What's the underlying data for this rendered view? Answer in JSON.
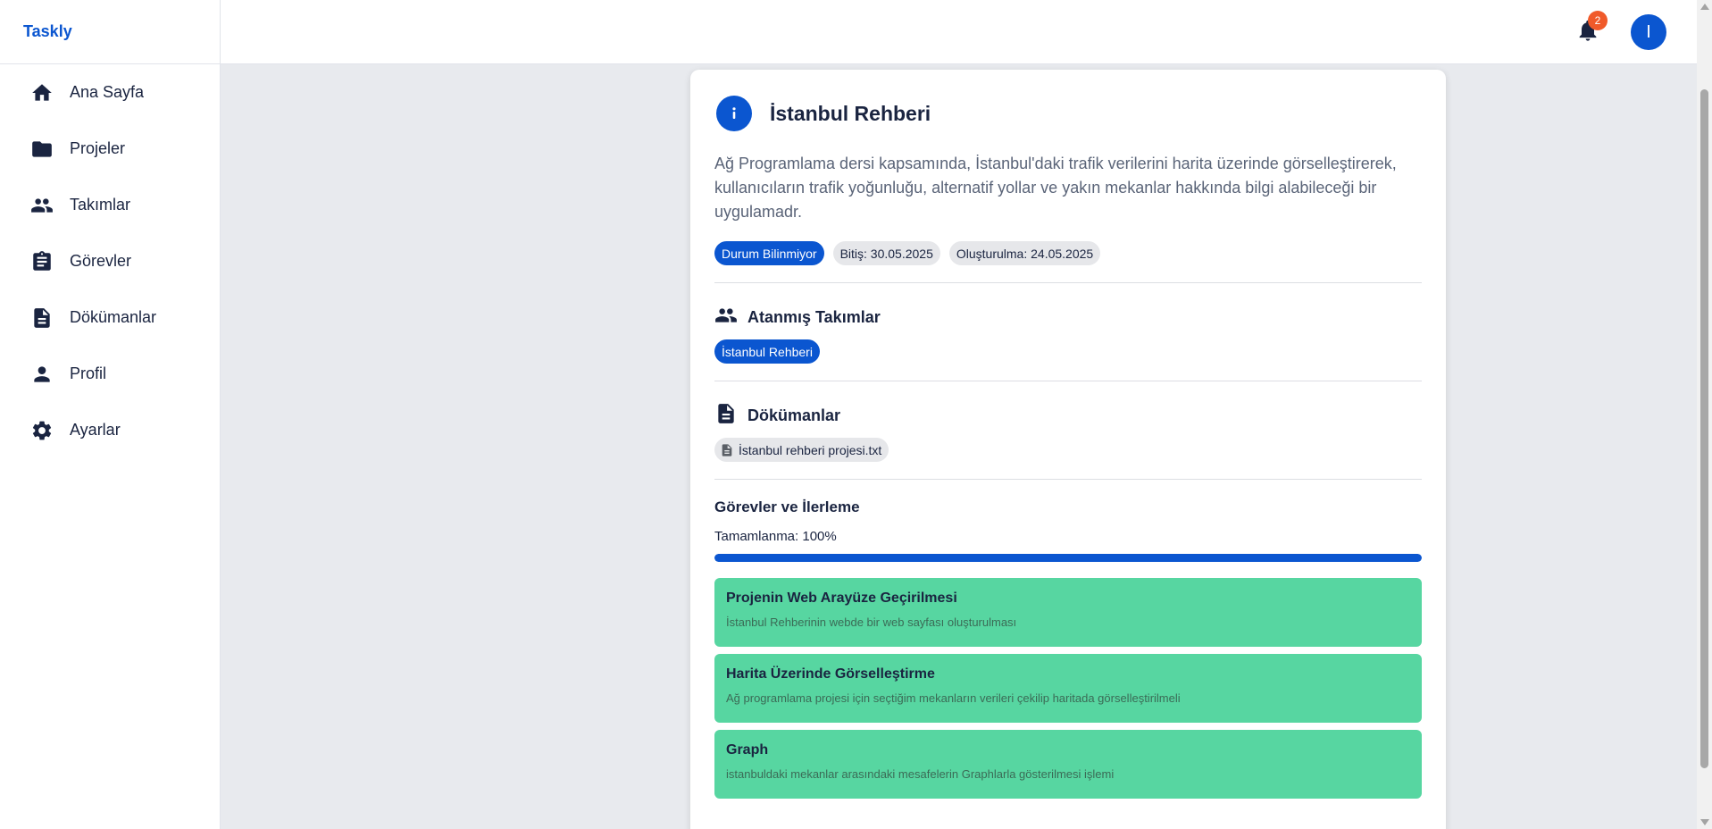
{
  "brand": {
    "name": "Taskly"
  },
  "sidebar": {
    "items": [
      {
        "label": "Ana Sayfa",
        "icon": "home-icon"
      },
      {
        "label": "Projeler",
        "icon": "folder-icon"
      },
      {
        "label": "Takımlar",
        "icon": "people-icon"
      },
      {
        "label": "Görevler",
        "icon": "clipboard-icon"
      },
      {
        "label": "Dökümanlar",
        "icon": "document-icon"
      },
      {
        "label": "Profil",
        "icon": "person-icon"
      },
      {
        "label": "Ayarlar",
        "icon": "gear-icon"
      }
    ]
  },
  "topbar": {
    "notification_count": "2",
    "avatar_initial": "I"
  },
  "project": {
    "title": "İstanbul Rehberi",
    "description": "Ağ Programlama dersi kapsamında, İstanbul'daki trafik verilerini harita üzerinde görselleştirerek, kullanıcıların trafik yoğunluğu, alternatif yollar ve yakın mekanlar hakkında bilgi alabileceği bir uygulamadr.",
    "status": "Durum Bilinmiyor",
    "due": "Bitiş: 30.05.2025",
    "created": "Oluşturulma: 24.05.2025"
  },
  "teams": {
    "title": "Atanmış Takımlar",
    "items": [
      "İstanbul Rehberi"
    ]
  },
  "documents": {
    "title": "Dökümanlar",
    "items": [
      "İstanbul rehberi projesi.txt"
    ]
  },
  "progress": {
    "title": "Görevler ve İlerleme",
    "label": "Tamamlanma: 100%",
    "percent": 100
  },
  "tasks": [
    {
      "title": "Projenin Web Arayüze Geçirilmesi",
      "description": "İstanbul Rehberinin webde bir web sayfası oluşturulması"
    },
    {
      "title": "Harita Üzerinde Görselleştirme",
      "description": "Ağ programlama projesi için seçtiğim mekanların verileri çekilip haritada görselleştirilmeli"
    },
    {
      "title": "Graph",
      "description": "istanbuldaki mekanlar arasındaki mesafelerin Graphlarla gösterilmesi işlemi"
    }
  ],
  "colors": {
    "primary": "#0b56d0",
    "task_done": "#57d6a1",
    "badge": "#f05a2a"
  }
}
